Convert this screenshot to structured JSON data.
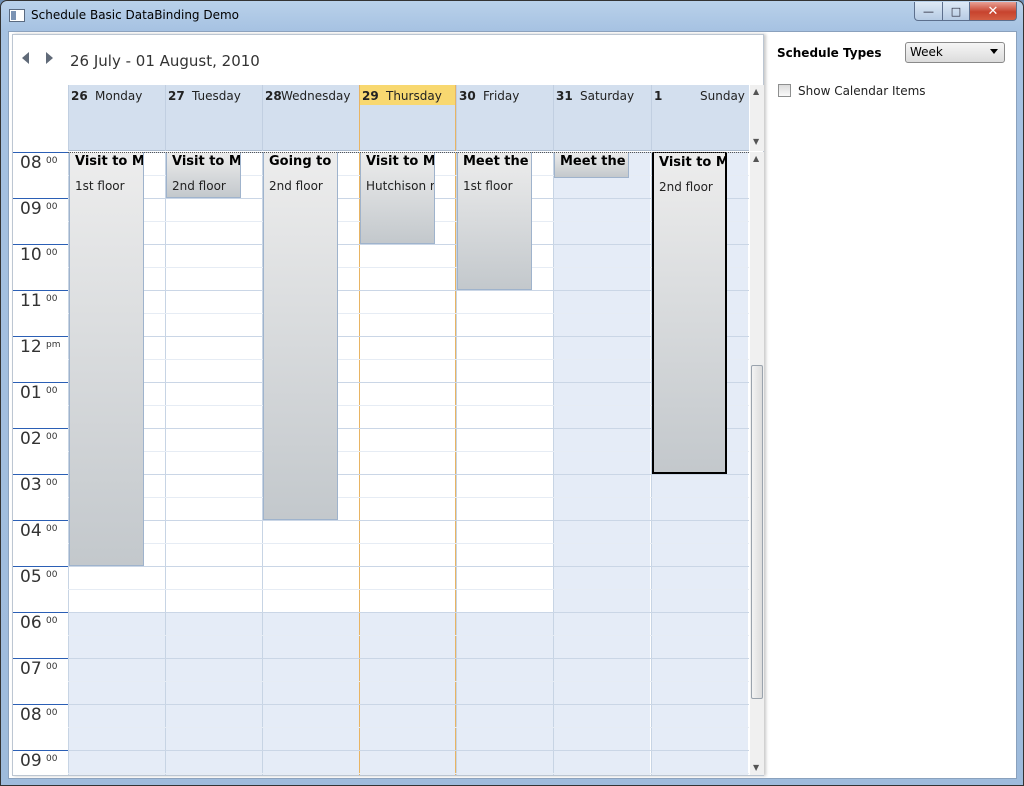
{
  "window": {
    "title": "Schedule Basic DataBinding Demo",
    "minimize": "—",
    "maximize": "□",
    "close": "✕"
  },
  "schedule": {
    "date_range": "26 July - 01 August, 2010",
    "days": [
      {
        "num": "26",
        "name": "Monday",
        "today": false,
        "weekend": false
      },
      {
        "num": "27",
        "name": "Tuesday",
        "today": false,
        "weekend": false
      },
      {
        "num": "28",
        "name": "Wednesday",
        "today": false,
        "weekend": false
      },
      {
        "num": "29",
        "name": "Thursday",
        "today": true,
        "weekend": false
      },
      {
        "num": "30",
        "name": "Friday",
        "today": false,
        "weekend": false
      },
      {
        "num": "31",
        "name": "Saturday",
        "today": false,
        "weekend": true
      },
      {
        "num": "1",
        "name": "Sunday",
        "today": false,
        "weekend": true
      }
    ],
    "times": [
      {
        "hour": "08",
        "sub": "00"
      },
      {
        "hour": "09",
        "sub": "00"
      },
      {
        "hour": "10",
        "sub": "00"
      },
      {
        "hour": "11",
        "sub": "00"
      },
      {
        "hour": "12",
        "sub": "pm"
      },
      {
        "hour": "01",
        "sub": "00"
      },
      {
        "hour": "02",
        "sub": "00"
      },
      {
        "hour": "03",
        "sub": "00"
      },
      {
        "hour": "04",
        "sub": "00"
      },
      {
        "hour": "05",
        "sub": "00"
      },
      {
        "hour": "06",
        "sub": "00"
      },
      {
        "hour": "07",
        "sub": "00"
      },
      {
        "hour": "08",
        "sub": "00"
      },
      {
        "hour": "09",
        "sub": "00"
      }
    ],
    "appointments": [
      {
        "subject": "Visit to Ma",
        "location": "1st floor",
        "day": 0,
        "start": 8.0,
        "end": 17.0,
        "selected": false
      },
      {
        "subject": "Visit to Ma",
        "location": "2nd floor",
        "day": 1,
        "start": 8.0,
        "end": 9.0,
        "selected": false
      },
      {
        "subject": "Going to P",
        "location": "2nd floor",
        "day": 2,
        "start": 8.0,
        "end": 16.0,
        "selected": false
      },
      {
        "subject": "Visit to Ma",
        "location": "Hutchison ro",
        "day": 3,
        "start": 8.0,
        "end": 10.0,
        "selected": false
      },
      {
        "subject": "Meet the d",
        "location": "1st floor",
        "day": 4,
        "start": 8.0,
        "end": 11.0,
        "selected": false
      },
      {
        "subject": "Meet the d",
        "location": "",
        "day": 5,
        "start": 8.0,
        "end": 8.5,
        "selected": false
      },
      {
        "subject": "Visit to Ma",
        "location": "2nd floor",
        "day": 6,
        "start": 8.0,
        "end": 15.0,
        "selected": true
      }
    ]
  },
  "panel": {
    "schedule_types_label": "Schedule Types",
    "schedule_type_value": "Week",
    "show_calendar_items_label": "Show Calendar Items",
    "show_calendar_items_checked": false
  },
  "colors": {
    "header_bg": "#d3dfee",
    "today_highlight": "#f8d870",
    "today_line": "#e8b463",
    "nonwork_bg": "#e5ecf7"
  }
}
